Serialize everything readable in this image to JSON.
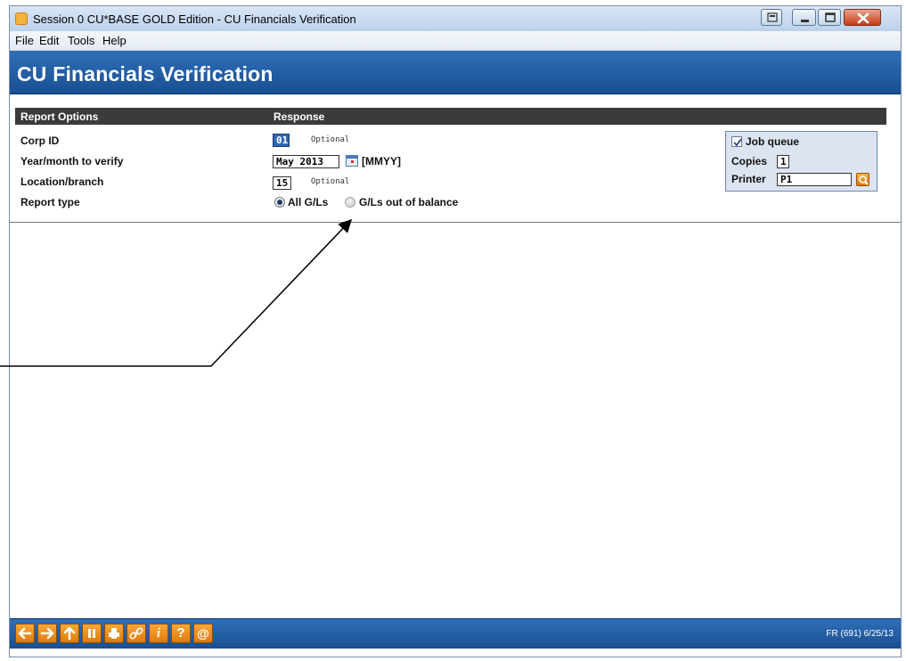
{
  "window": {
    "title": "Session 0 CU*BASE GOLD Edition - CU Financials Verification"
  },
  "menu": [
    "File",
    "Edit",
    "Tools",
    "Help"
  ],
  "header": {
    "title": "CU Financials Verification"
  },
  "options_bar": {
    "col1": "Report Options",
    "col2": "Response"
  },
  "form": {
    "corp_id": {
      "label": "Corp ID",
      "value": "01",
      "hint": "Optional"
    },
    "year_month": {
      "label": "Year/month to verify",
      "value": "May 2013",
      "format": "[MMYY]"
    },
    "location": {
      "label": "Location/branch",
      "value": "15",
      "hint": "Optional"
    },
    "report_type": {
      "label": "Report type",
      "options": [
        "All G/Ls",
        "G/Ls out of balance"
      ],
      "selected": "All G/Ls"
    }
  },
  "job": {
    "job_queue_label": "Job queue",
    "job_queue_checked": true,
    "copies_label": "Copies",
    "copies": "1",
    "printer_label": "Printer",
    "printer": "P1"
  },
  "footer": {
    "buttons": [
      "back-arrow",
      "forward-arrow",
      "up-arrow",
      "pause",
      "print",
      "link",
      "info",
      "help",
      "email"
    ],
    "info": "FR (691) 6/25/13"
  }
}
